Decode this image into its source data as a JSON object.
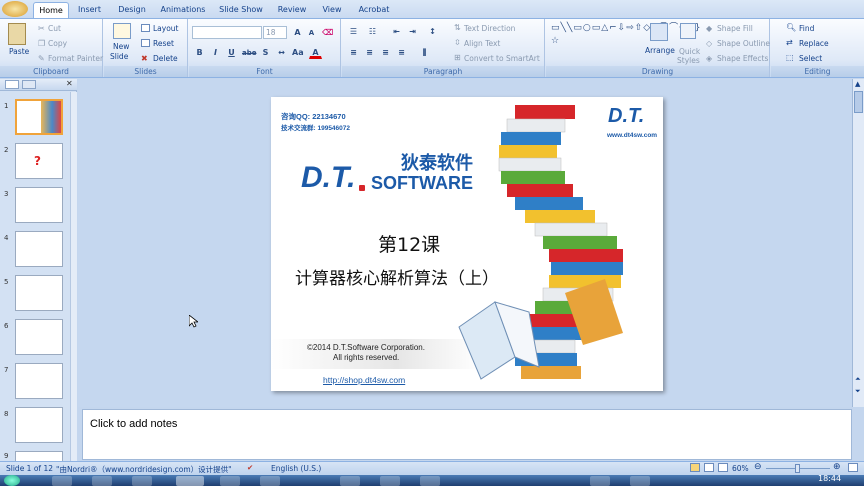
{
  "tabs": [
    "Home",
    "Insert",
    "Design",
    "Animations",
    "Slide Show",
    "Review",
    "View",
    "Acrobat"
  ],
  "clipboard": {
    "paste": "Paste",
    "cut": "Cut",
    "copy": "Copy",
    "format_painter": "Format Painter",
    "label": "Clipboard"
  },
  "slides": {
    "new_slide": "New",
    "new_slide2": "Slide",
    "layout": "Layout",
    "reset": "Reset",
    "delete": "Delete",
    "label": "Slides"
  },
  "font": {
    "size": "18",
    "label": "Font",
    "bold": "B",
    "italic": "I",
    "underline": "U",
    "strike": "abe",
    "shadow": "S"
  },
  "paragraph": {
    "text_direction": "Text Direction",
    "align_text": "Align Text",
    "convert": "Convert to SmartArt",
    "label": "Paragraph"
  },
  "drawing": {
    "arrange": "Arrange",
    "quick_styles": "Quick",
    "quick_styles2": "Styles",
    "shape_fill": "Shape Fill",
    "shape_outline": "Shape Outline",
    "shape_effects": "Shape Effects",
    "label": "Drawing"
  },
  "editing": {
    "find": "Find",
    "replace": "Replace",
    "select": "Select",
    "label": "Editing"
  },
  "slide": {
    "qq_label": "咨询QQ: 22134670",
    "group_label": "技术交流群: 199546072",
    "logo_dt": "D.T.",
    "logo_web": "www.dt4sw.com",
    "brand_cn": "狄泰软件",
    "brand_dt": "D.T.",
    "brand_software": "SOFTWARE",
    "lesson": "第12课",
    "title": "计算器核心解析算法（上）",
    "copyright1": "©2014  D.T.Software Corporation.",
    "copyright2": "All rights reserved.",
    "link": "http://shop.dt4sw.com"
  },
  "thumb_numbers": [
    "1",
    "2",
    "3",
    "4",
    "5",
    "6",
    "7",
    "8",
    "9"
  ],
  "notes": {
    "placeholder": "Click to add notes"
  },
  "status": {
    "slide_info": "Slide 1 of 12",
    "theme": "\"由Nordri®（www.nordridesign.com）设计提供\"",
    "language": "English (U.S.)",
    "zoom": "60%",
    "zoom_fraction": 0.5
  },
  "taskbar": {
    "time": "18:44"
  },
  "colors": {
    "accent": "#15428b",
    "slide_red": "#d6262a",
    "slide_blue": "#1c5aa8"
  }
}
